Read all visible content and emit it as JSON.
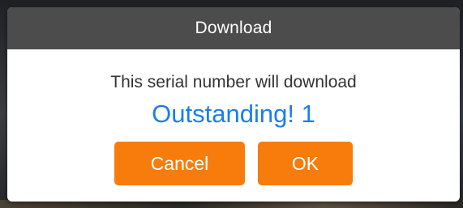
{
  "dialog": {
    "title": "Download",
    "message": "This serial number will download",
    "highlight": "Outstanding! 1",
    "buttons": {
      "cancel_label": "Cancel",
      "ok_label": "OK"
    }
  },
  "colors": {
    "header_bg": "#4c4c4c",
    "highlight_text": "#1a7fe8",
    "button_bg": "#f77c0c",
    "dialog_bg": "#ffffff"
  }
}
